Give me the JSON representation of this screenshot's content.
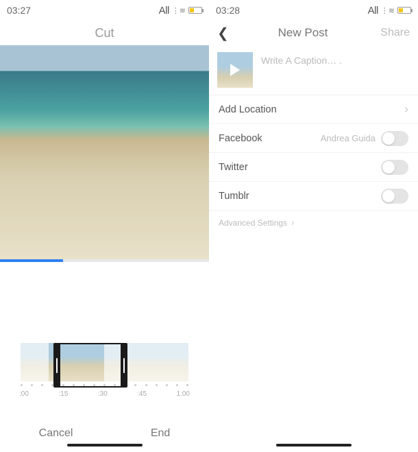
{
  "left": {
    "status": {
      "time": "03:27",
      "carrier_label": "All"
    },
    "title": "Cut",
    "timeline": {
      "ticks": [
        ":00",
        ":15",
        ":30",
        ":45",
        "1:00"
      ]
    },
    "actions": {
      "cancel": "Cancel",
      "end": "End"
    }
  },
  "right": {
    "status": {
      "time": "03:28",
      "carrier_label": "All"
    },
    "nav": {
      "title": "New Post",
      "share": "Share"
    },
    "caption_placeholder": "Write A Caption… .",
    "rows": {
      "add_location": "Add Location",
      "facebook": {
        "label": "Facebook",
        "account": "Andrea Guida"
      },
      "twitter": "Twitter",
      "tumblr": "Tumblr"
    },
    "advanced": "Advanced Settings"
  }
}
